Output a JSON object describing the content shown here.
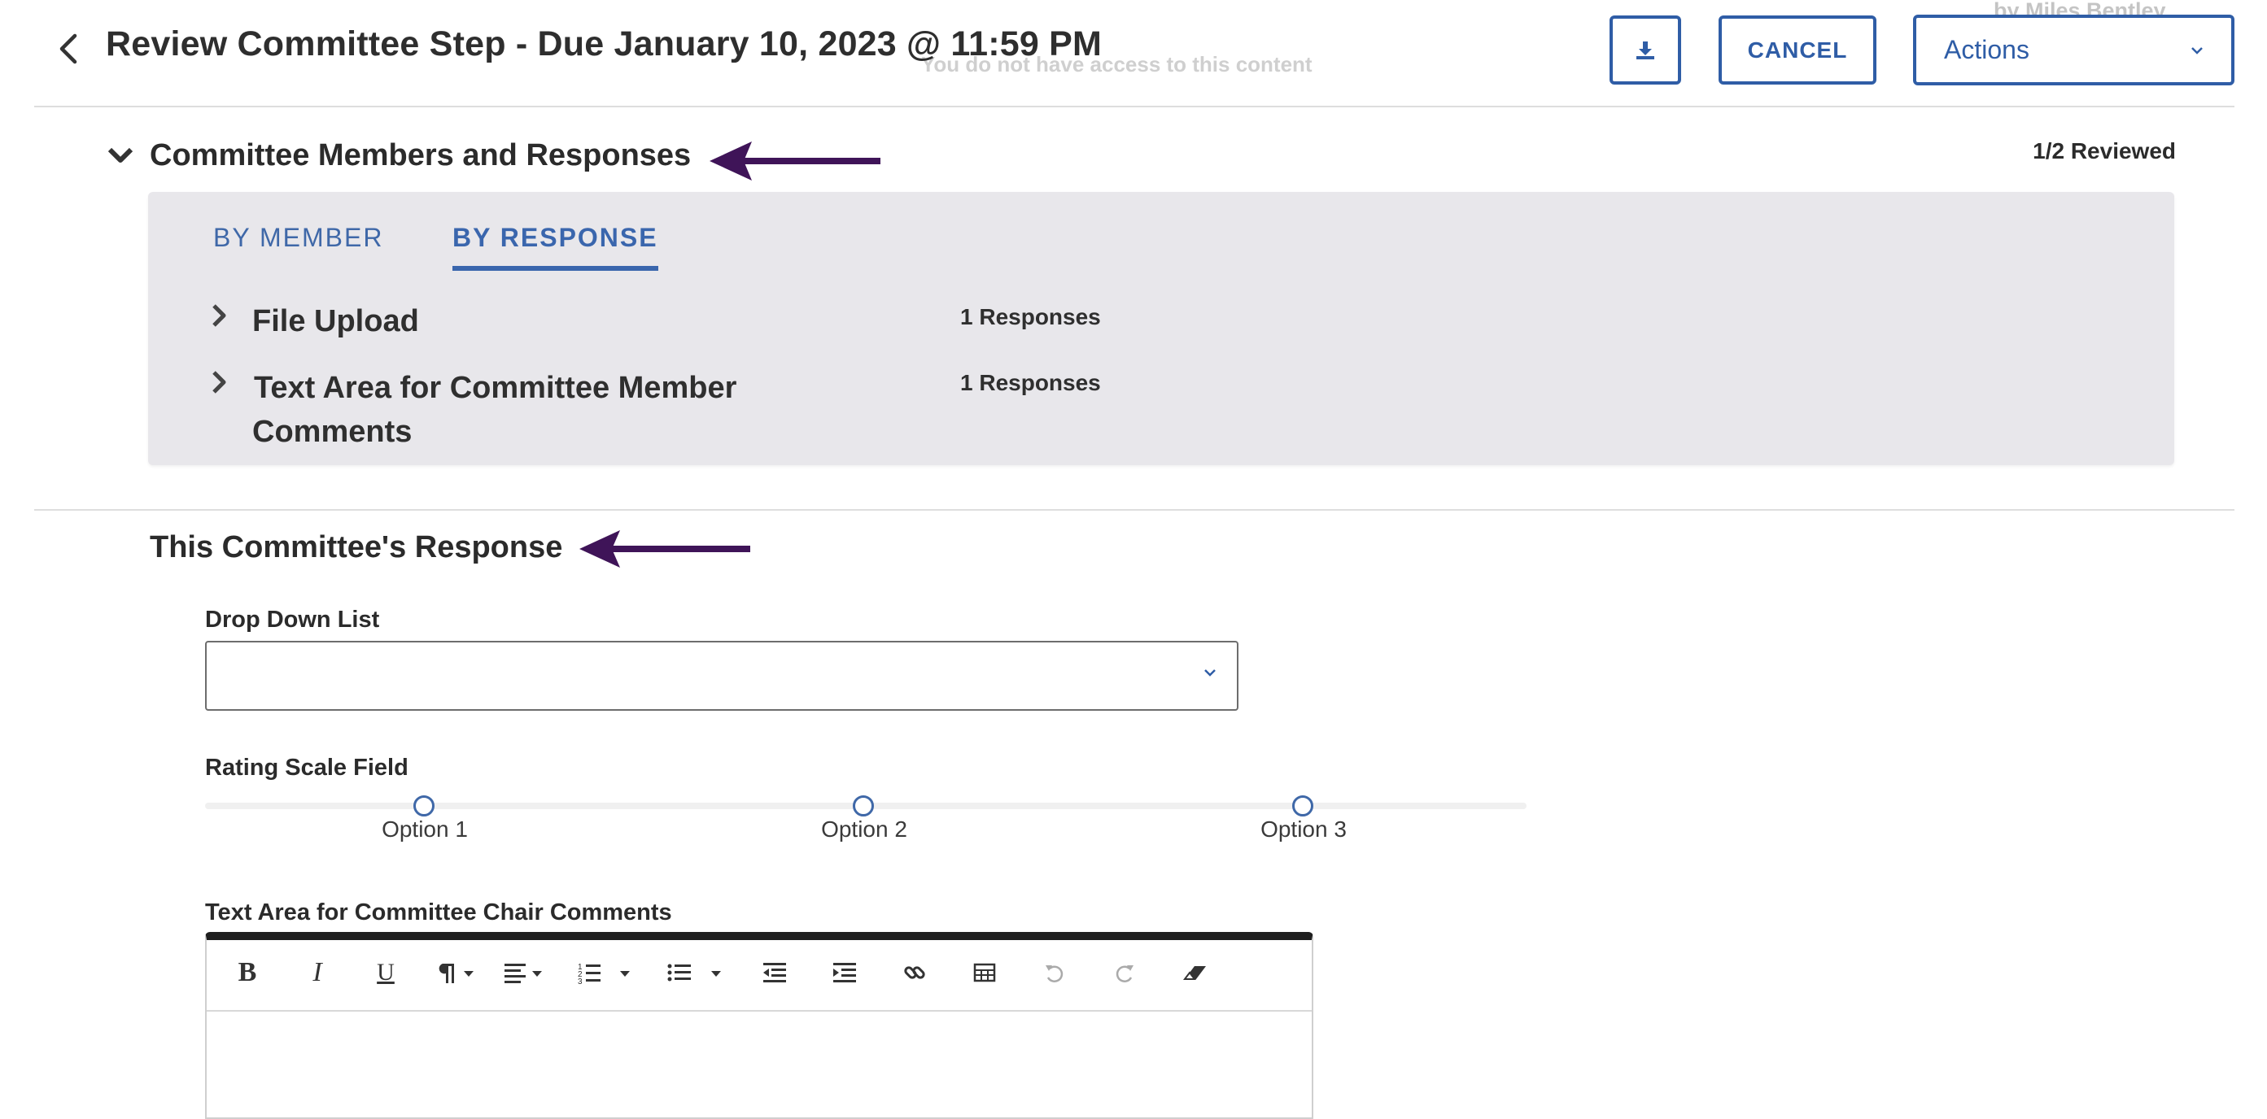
{
  "header": {
    "title": "Review Committee Step - Due January 10, 2023 @ 11:59 PM",
    "ghost_author": "by Miles Bentley",
    "ghost_notice": "You do not have access to this content",
    "cancel_label": "CANCEL",
    "actions_label": "Actions"
  },
  "committee": {
    "title": "Committee Members and Responses",
    "reviewed": "1/2 Reviewed",
    "tabs": [
      {
        "label": "BY MEMBER",
        "active": false
      },
      {
        "label": "BY RESPONSE",
        "active": true
      }
    ],
    "responses": [
      {
        "name": "File Upload",
        "count": "1 Responses"
      },
      {
        "name": "Text Area for Committee Member Comments",
        "count": "1 Responses"
      }
    ]
  },
  "this_response": {
    "title": "This Committee's Response",
    "dropdown": {
      "label": "Drop Down List",
      "value": ""
    },
    "rating": {
      "label": "Rating Scale Field",
      "options": [
        "Option 1",
        "Option 2",
        "Option 3"
      ]
    },
    "textarea": {
      "label": "Text Area for Committee Chair Comments",
      "toolbar": [
        "bold",
        "italic",
        "underline",
        "paragraph-format",
        "align",
        "ordered-list",
        "unordered-list",
        "outdent",
        "indent",
        "link",
        "table",
        "undo",
        "redo",
        "clear-formatting"
      ]
    }
  },
  "colors": {
    "accent": "#2f5da6",
    "arrow": "#3f1458",
    "panel_bg": "#e8e7eb"
  },
  "icons": [
    "back-chevron-icon",
    "download-icon",
    "chevron-down-icon",
    "chevron-right-icon",
    "arrow-left-icon"
  ]
}
